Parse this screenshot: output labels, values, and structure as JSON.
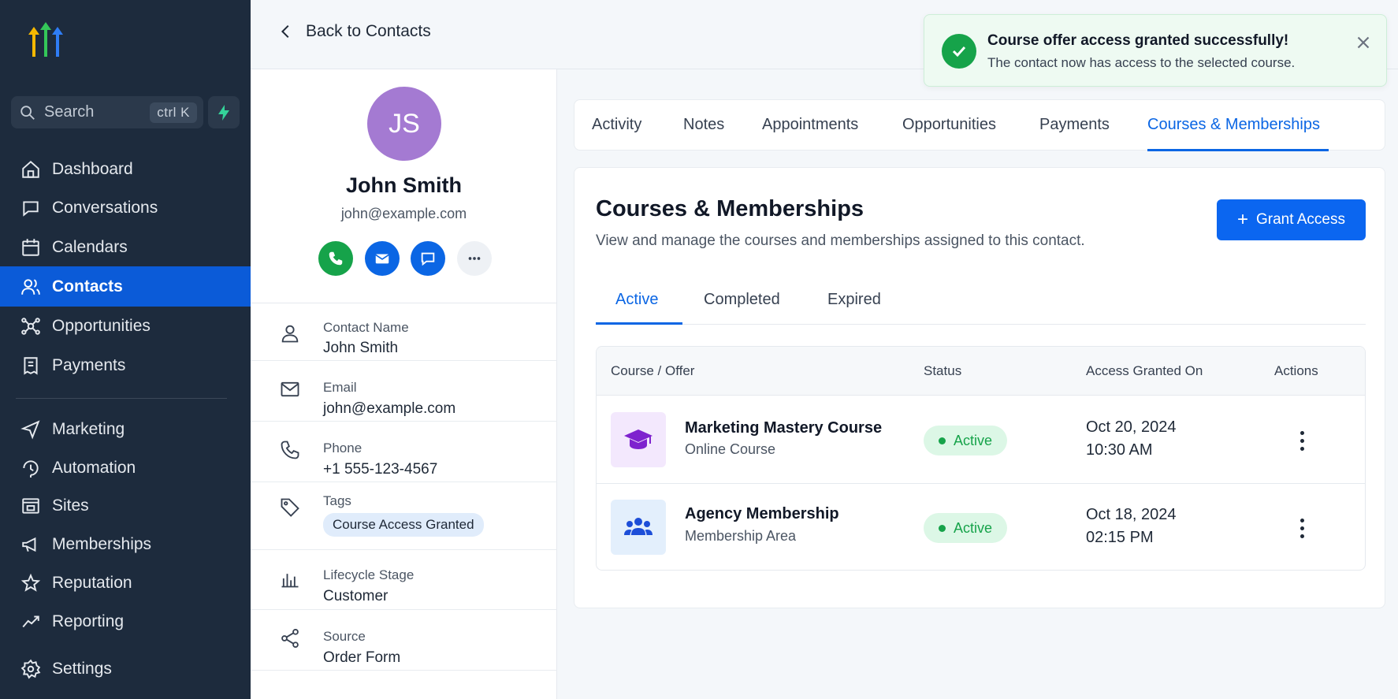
{
  "sidebar": {
    "search": {
      "placeholder": "Search",
      "shortcut": "ctrl  K"
    },
    "items": [
      {
        "label": "Dashboard",
        "icon": "home-icon"
      },
      {
        "label": "Conversations",
        "icon": "chat-bubble-icon"
      },
      {
        "label": "Calendars",
        "icon": "calendar-icon"
      },
      {
        "label": "Contacts",
        "icon": "users-icon",
        "active": true
      },
      {
        "label": "Opportunities",
        "icon": "network-icon"
      },
      {
        "label": "Payments",
        "icon": "receipt-icon"
      },
      {
        "label": "Marketing",
        "icon": "send-icon"
      },
      {
        "label": "Automation",
        "icon": "automation-icon"
      },
      {
        "label": "Sites",
        "icon": "browser-icon"
      },
      {
        "label": "Memberships",
        "icon": "megaphone-icon"
      },
      {
        "label": "Reputation",
        "icon": "star-icon"
      },
      {
        "label": "Reporting",
        "icon": "trend-icon"
      },
      {
        "label": "Settings",
        "icon": "gear-icon"
      }
    ]
  },
  "topbar": {
    "back_label": "Back to Contacts"
  },
  "contact": {
    "initials": "JS",
    "name": "John Smith",
    "email": "john@example.com",
    "fields": {
      "name_label": "Contact Name",
      "name_value": "John Smith",
      "email_label": "Email",
      "email_value": "john@example.com",
      "phone_label": "Phone",
      "phone_value": "+1 555-123-4567",
      "tags_label": "Tags",
      "tag_value": "Course Access Granted",
      "lifecycle_label": "Lifecycle Stage",
      "lifecycle_value": "Customer",
      "source_label": "Source",
      "source_value": "Order Form"
    }
  },
  "tabs": [
    "Activity",
    "Notes",
    "Appointments",
    "Opportunities",
    "Payments",
    "Courses & Memberships"
  ],
  "courses": {
    "title": "Courses & Memberships",
    "subtitle": "View and manage the courses and memberships assigned to this contact.",
    "grant_label": "Grant Access",
    "subtabs": [
      "Active",
      "Completed",
      "Expired"
    ],
    "columns": [
      "Course / Offer",
      "Status",
      "Access Granted On",
      "Actions"
    ],
    "rows": [
      {
        "name": "Marketing Mastery Course",
        "type": "Online Course",
        "status": "Active",
        "date": "Oct 20, 2024",
        "time": "10:30 AM",
        "icon": "graduation-cap-icon"
      },
      {
        "name": "Agency Membership",
        "type": "Membership Area",
        "status": "Active",
        "date": "Oct 18, 2024",
        "time": "02:15 PM",
        "icon": "group-icon"
      }
    ]
  },
  "toast": {
    "title": "Course offer access granted successfully!",
    "message": "The contact now has access to the selected course."
  },
  "colors": {
    "sidebar": "#1d2b3d",
    "accent": "#0b66e4",
    "success": "#16a34a"
  }
}
